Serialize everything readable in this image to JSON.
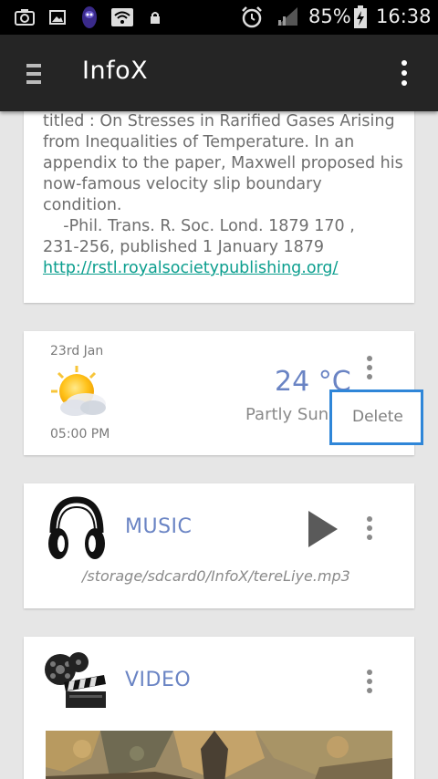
{
  "status_bar": {
    "battery_percent": "85%",
    "time": "16:38",
    "icons": [
      "screenshot-icon",
      "gallery-icon",
      "app-notification-icon",
      "wifi-icon",
      "lock-icon",
      "alarm-icon",
      "signal-icon",
      "battery-charging-icon"
    ]
  },
  "app_bar": {
    "title": "InfoX",
    "menu_icon": "hamburger-icon",
    "overflow_icon": "more-vert-icon"
  },
  "text_card": {
    "lines": [
      "titled : On Stresses in Rarified Gases Arising",
      "from Inequalities of Temperature. In an",
      "appendix to the paper, Maxwell proposed his",
      "now-famous velocity slip boundary",
      "condition.",
      "    -Phil. Trans. R. Soc. Lond. 1879 170 ,",
      "231-256, published 1 January 1879"
    ],
    "link": "http://rstl.royalsocietypublishing.org/"
  },
  "weather_card": {
    "date": "23rd Jan",
    "time": "05:00 PM",
    "temperature": "24 °C",
    "condition": "Partly Sunny",
    "icon": "partly-sunny-icon"
  },
  "popup_menu": {
    "items": [
      "Delete"
    ]
  },
  "music_card": {
    "label": "MUSIC",
    "path": "/storage/sdcard0/InfoX/tereLiye.mp3",
    "icon": "headphones-icon"
  },
  "video_card": {
    "label": "VIDEO",
    "icon": "clapperboard-icon"
  },
  "colors": {
    "accent": "#6a84c4",
    "link": "#0b9e8e",
    "popup_border": "#2f86d8",
    "app_bar": "#252525"
  }
}
